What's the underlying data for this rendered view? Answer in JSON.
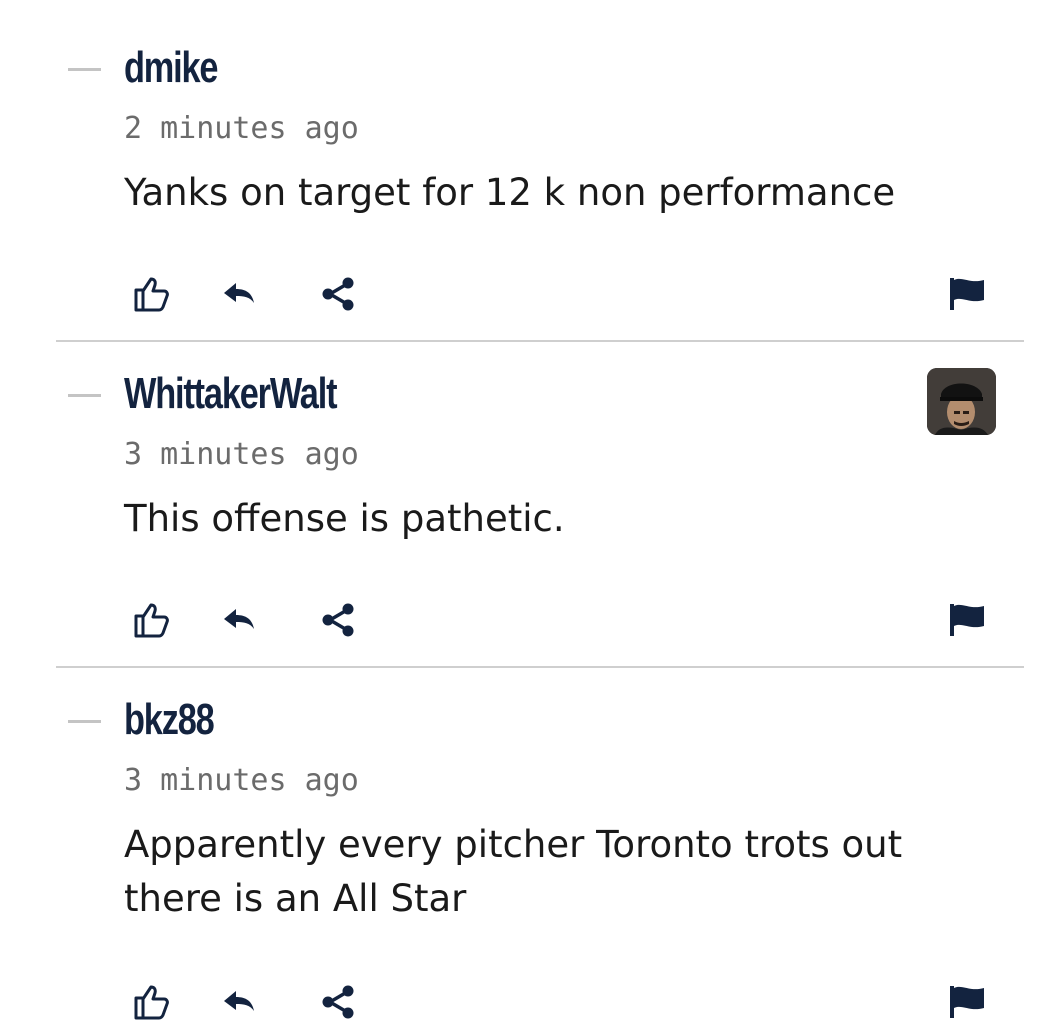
{
  "colors": {
    "accent": "#13233f",
    "meta": "#6b6b6b",
    "divider": "#cfcfcf",
    "dash": "#c4c4c4"
  },
  "icons": [
    "thumbs-up-icon",
    "reply-icon",
    "share-icon",
    "flag-icon",
    "collapse-dash-icon"
  ],
  "comments": [
    {
      "username": "dmike",
      "time": "2 minutes ago",
      "body": "Yanks on target for 12 k non performance",
      "has_avatar": false
    },
    {
      "username": "WhittakerWalt",
      "time": "3 minutes ago",
      "body": "This offense is pathetic.",
      "has_avatar": true
    },
    {
      "username": "bkz88",
      "time": "3 minutes ago",
      "body": "Apparently every pitcher Toronto trots out there is an All Star",
      "has_avatar": false
    }
  ]
}
